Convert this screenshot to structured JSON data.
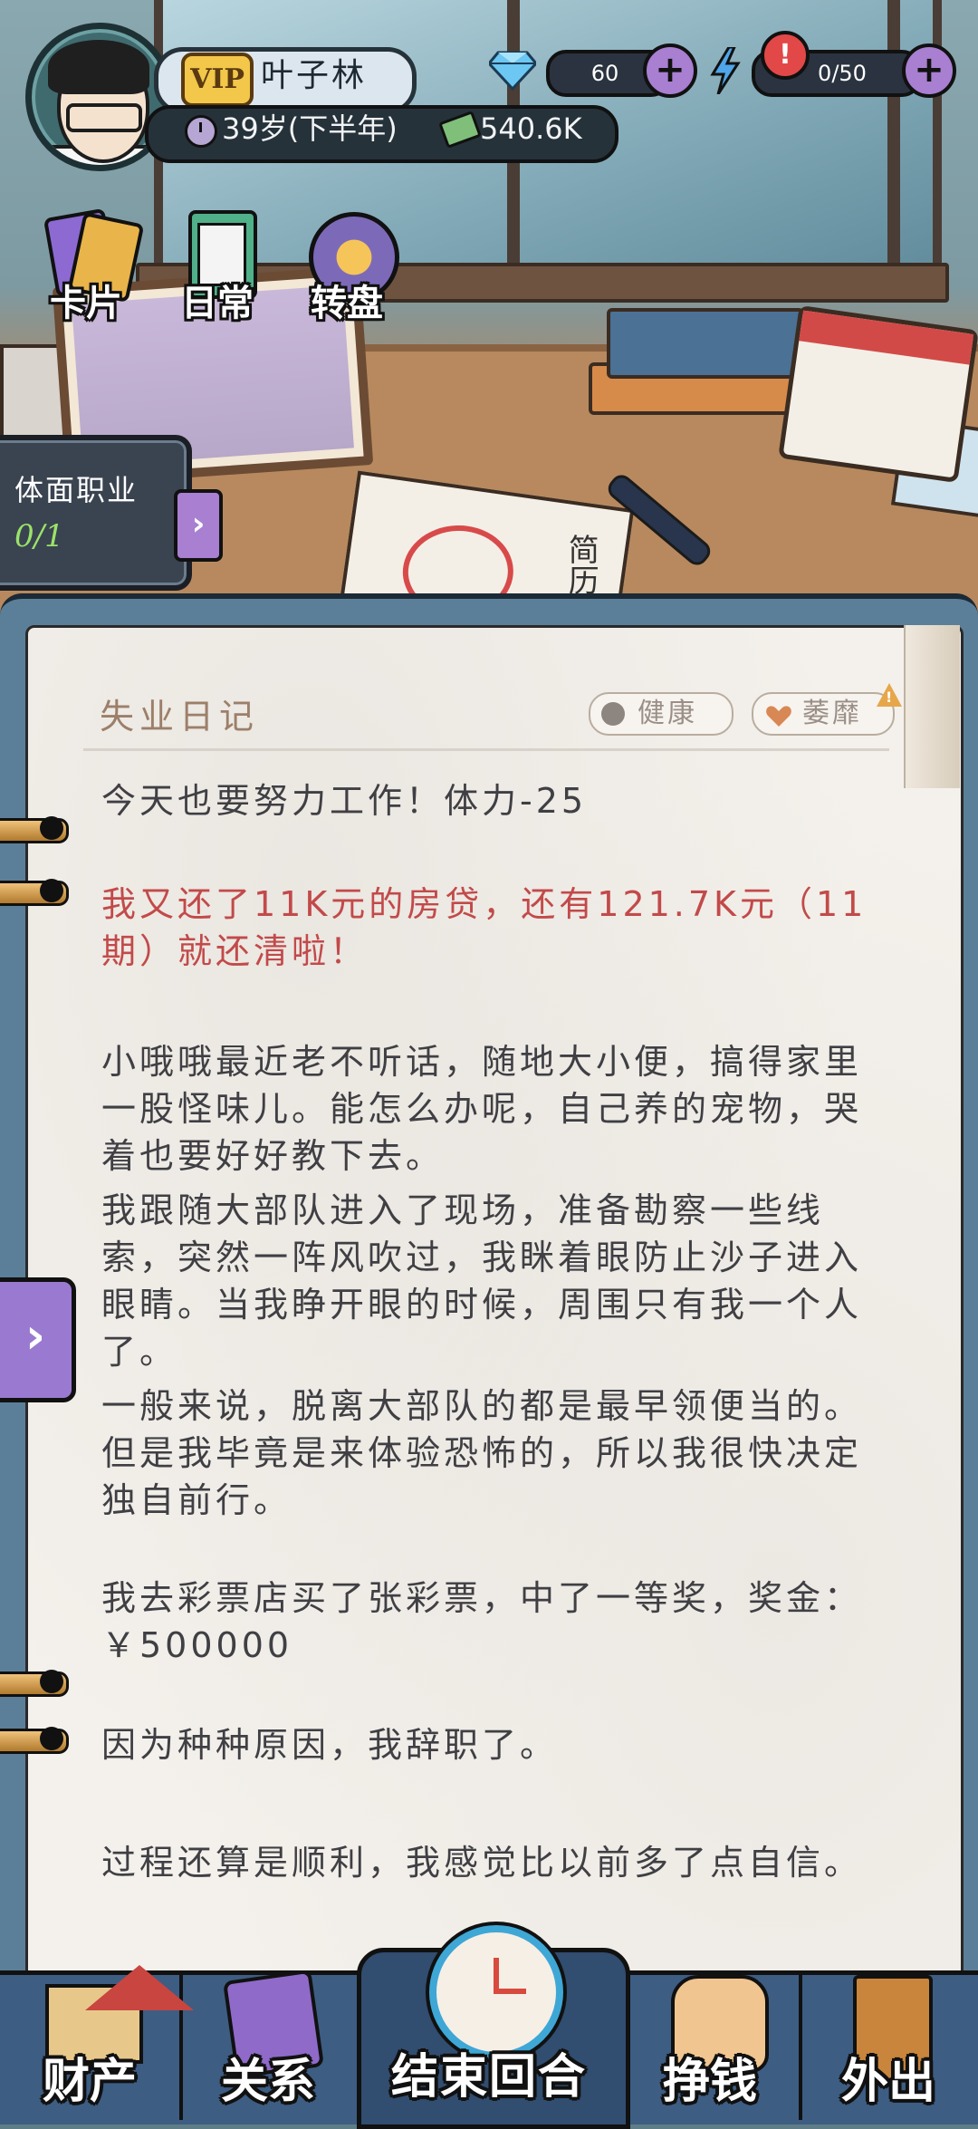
{
  "player": {
    "vip_label": "VIP",
    "name": "叶子林",
    "age": "39岁(下半年)",
    "money": "540.6K"
  },
  "resources": {
    "gems": "60",
    "energy": "0/50",
    "alert_symbol": "!",
    "plus_symbol": "+"
  },
  "features": [
    {
      "label": "卡片",
      "icon": "cards-icon"
    },
    {
      "label": "日常",
      "icon": "clipboard-icon"
    },
    {
      "label": "转盘",
      "icon": "wheel-icon"
    }
  ],
  "career": {
    "title": "体面职业",
    "progress": "0/1",
    "arrow": "›"
  },
  "scene": {
    "resume_text": "简历"
  },
  "diary": {
    "title": "失业日记",
    "health_label": "健康",
    "mood_label": "萎靡",
    "entries": [
      {
        "text": "今天也要努力工作！体力-25",
        "color": "normal"
      },
      {
        "text": "我又还了11K元的房贷，还有121.7K元（11期）就还清啦！",
        "color": "red"
      },
      {
        "text": "小哦哦最近老不听话，随地大小便，搞得家里一股怪味儿。能怎么办呢，自己养的宠物，哭着也要好好教下去。",
        "color": "normal"
      },
      {
        "text": "我跟随大部队进入了现场，准备勘察一些线索，突然一阵风吹过，我眯着眼防止沙子进入眼睛。当我睁开眼的时候，周围只有我一个人了。",
        "color": "normal"
      },
      {
        "text": "一般来说，脱离大部队的都是最早领便当的。但是我毕竟是来体验恐怖的，所以我很快决定独自前行。",
        "color": "normal"
      },
      {
        "text": "我去彩票店买了张彩票，中了一等奖，奖金：￥500000",
        "color": "normal"
      },
      {
        "text": "因为种种原因，我辞职了。",
        "color": "normal"
      },
      {
        "text": "过程还算是顺利，我感觉比以前多了点自信。",
        "color": "normal"
      }
    ],
    "side_tab_arrow": "›"
  },
  "nav": {
    "assets": "财产",
    "relations": "关系",
    "end_turn": "结束回合",
    "earn_money": "挣钱",
    "go_out": "外出"
  },
  "colors": {
    "accent_purple": "#a87fd1",
    "diary_red": "#c24a4a",
    "nav_blue": "#3d5d83",
    "vip_gold": "#f2c74a"
  }
}
